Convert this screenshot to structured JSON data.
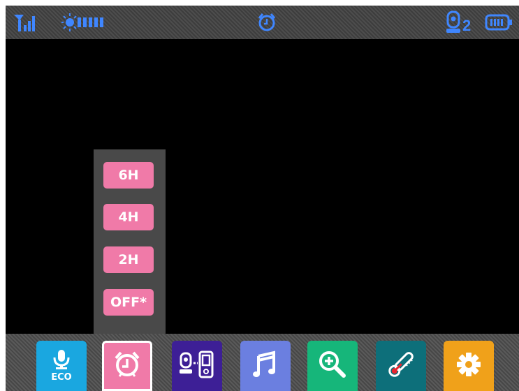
{
  "status_bar": {
    "camera_number": "2",
    "icons": [
      "signal-icon",
      "light-level-icon",
      "alarm-clock-icon",
      "camera-icon",
      "battery-icon"
    ]
  },
  "timer_menu": {
    "options": [
      "6H",
      "4H",
      "2H",
      "OFF*"
    ],
    "selected": "OFF*"
  },
  "toolbar": {
    "items": [
      {
        "name": "eco-mode",
        "label": "ECO",
        "color": "#1aa7e0"
      },
      {
        "name": "alarm-timer",
        "color": "#f07aa8",
        "selected": true
      },
      {
        "name": "camera-pairing",
        "color": "#3d1f96"
      },
      {
        "name": "lullaby-music",
        "color": "#6b7fe0"
      },
      {
        "name": "zoom",
        "color": "#16b67a"
      },
      {
        "name": "temperature",
        "color": "#0d6f7a"
      },
      {
        "name": "settings",
        "color": "#f0a11a"
      }
    ]
  }
}
